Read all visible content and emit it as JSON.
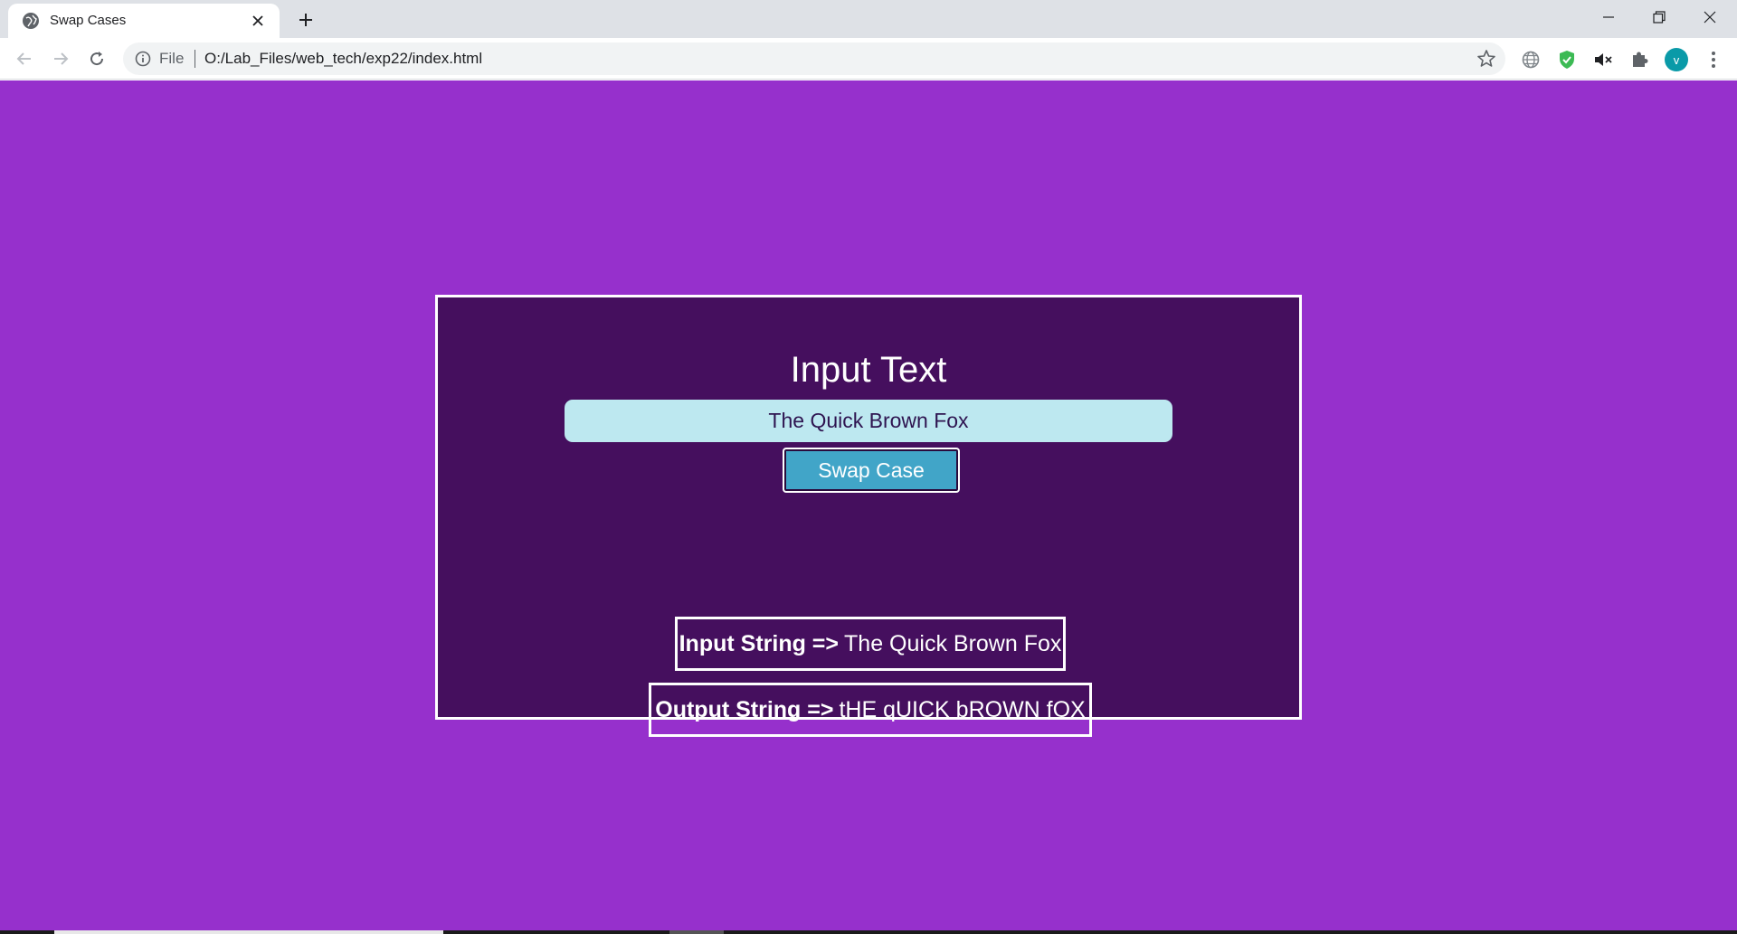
{
  "browser": {
    "tab_title": "Swap Cases",
    "url_scheme": "File",
    "url": "O:/Lab_Files/web_tech/exp22/index.html",
    "avatar_letter": "v",
    "icons": {
      "favicon": "globe-icon",
      "tab_close": "close-icon",
      "new_tab": "plus-icon",
      "minimize": "minimize-icon",
      "maximize": "restore-icon",
      "close_window": "close-icon",
      "back": "arrow-left-icon",
      "forward": "arrow-right-icon",
      "reload": "reload-icon",
      "site_info": "info-icon",
      "bookmark": "star-icon",
      "extensions": [
        "globe-extension-icon",
        "shield-check-icon",
        "mute-icon",
        "puzzle-icon"
      ],
      "menu": "kebab-menu-icon"
    }
  },
  "page": {
    "background": "#9630cc",
    "card_background": "#450f5e",
    "heading": "Input Text",
    "input_value": "The Quick Brown Fox",
    "button_label": "Swap Case",
    "button_color": "#41a5c8",
    "input_label": "Input String =>",
    "input_result": "The Quick Brown Fox",
    "output_label": "Output String =>",
    "output_result": "tHE qUICK bROWN fOX"
  }
}
